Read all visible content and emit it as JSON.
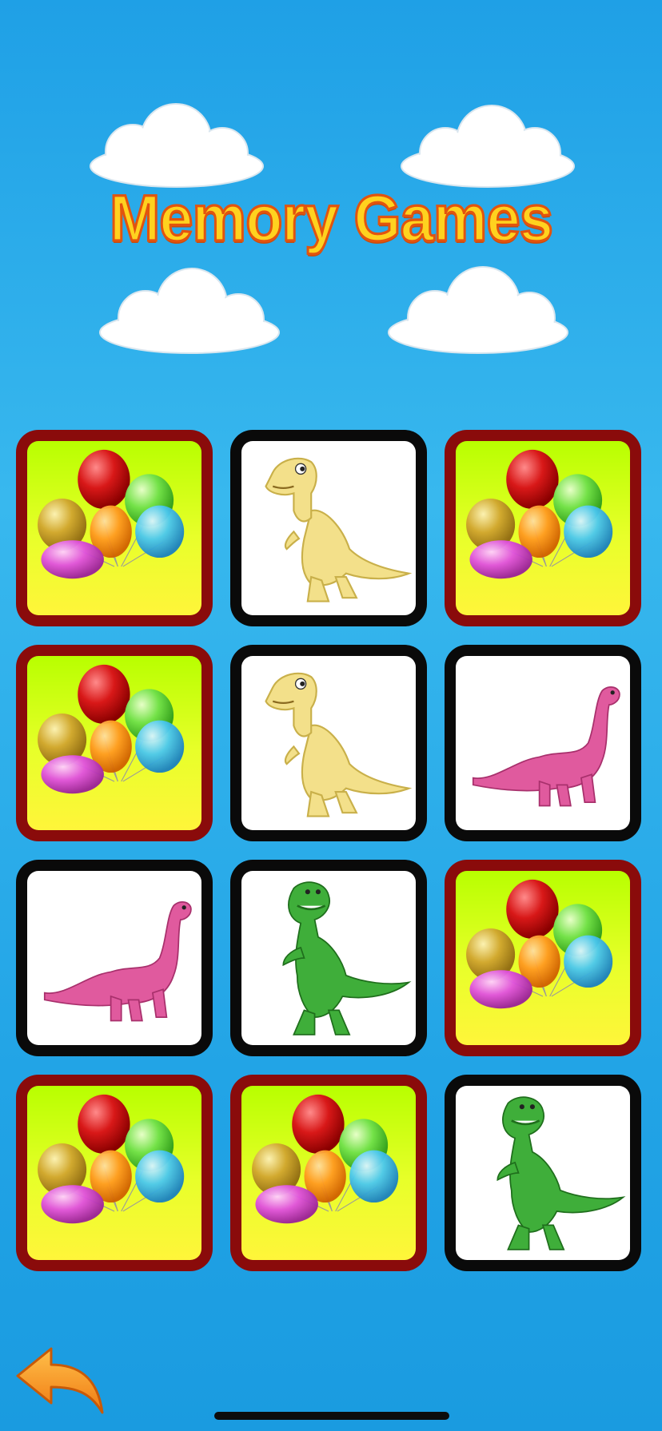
{
  "app": {
    "title": "Memory Games"
  },
  "colors": {
    "background": "#2aaae8",
    "title_fill": "#ffd21f",
    "title_stroke": "#e2540e",
    "card_back_border": "#8a0b0b",
    "card_face_border": "#0a0a0a"
  },
  "board": {
    "columns": 3,
    "rows": 4,
    "cards": [
      {
        "state": "face-down",
        "image": "balloons-icon"
      },
      {
        "state": "face-up",
        "image": "yellow-dinosaur-icon"
      },
      {
        "state": "face-down",
        "image": "balloons-icon"
      },
      {
        "state": "face-down",
        "image": "balloons-icon"
      },
      {
        "state": "face-up",
        "image": "yellow-dinosaur-icon"
      },
      {
        "state": "face-up",
        "image": "pink-dinosaur-icon"
      },
      {
        "state": "face-up",
        "image": "pink-dinosaur-icon"
      },
      {
        "state": "face-up",
        "image": "green-dinosaur-icon"
      },
      {
        "state": "face-down",
        "image": "balloons-icon"
      },
      {
        "state": "face-down",
        "image": "balloons-icon"
      },
      {
        "state": "face-down",
        "image": "balloons-icon"
      },
      {
        "state": "face-up",
        "image": "green-dinosaur-icon"
      }
    ]
  },
  "navigation": {
    "back_icon": "back-arrow-icon"
  }
}
